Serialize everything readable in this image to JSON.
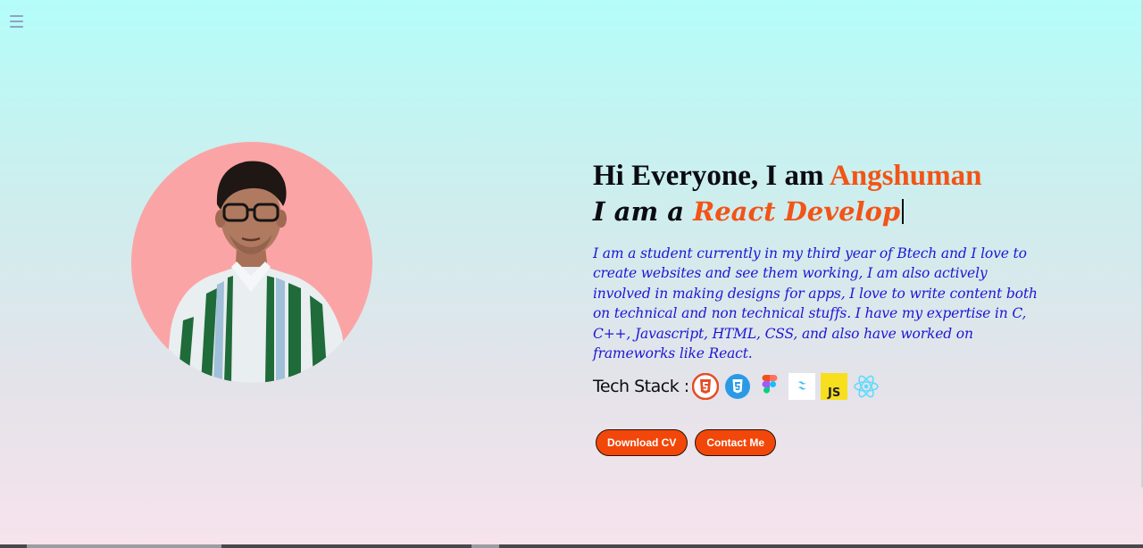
{
  "menu": {
    "icon": "hamburger-menu-icon"
  },
  "profile": {
    "image": "profile-photo"
  },
  "hero": {
    "greeting_prefix": "Hi Everyone, I am ",
    "name": "Angshuman",
    "typed_prefix": "I am a ",
    "typed_role": "React Develop",
    "bio": "I am a student currently in my third year of Btech and I love to create websites and see them working, I am also actively involved in making designs for apps, I love to write content both on technical and non technical stuffs. I have my expertise in C, C++, Javascript, HTML, CSS, and also have worked on frameworks like React."
  },
  "tech_stack": {
    "label": "Tech Stack :",
    "items": [
      {
        "name": "HTML5",
        "icon": "html5-icon",
        "color": "#e44d26"
      },
      {
        "name": "CSS3",
        "icon": "css3-icon",
        "color": "#2b9ae6"
      },
      {
        "name": "Figma",
        "icon": "figma-icon",
        "color": "#f24e1e"
      },
      {
        "name": "Tailwind CSS",
        "icon": "tailwind-icon",
        "color": "#38bdf8"
      },
      {
        "name": "JS",
        "icon": "javascript-icon",
        "color": "#f7df1e"
      },
      {
        "name": "React",
        "icon": "react-icon",
        "color": "#61dafb"
      }
    ]
  },
  "actions": {
    "download_cv": "Download CV",
    "contact_me": "Contact Me"
  },
  "colors": {
    "accent": "#f25417",
    "bio_text": "#1d17d4",
    "button": "#f2470a",
    "avatar_bg": "#fba4a6"
  }
}
